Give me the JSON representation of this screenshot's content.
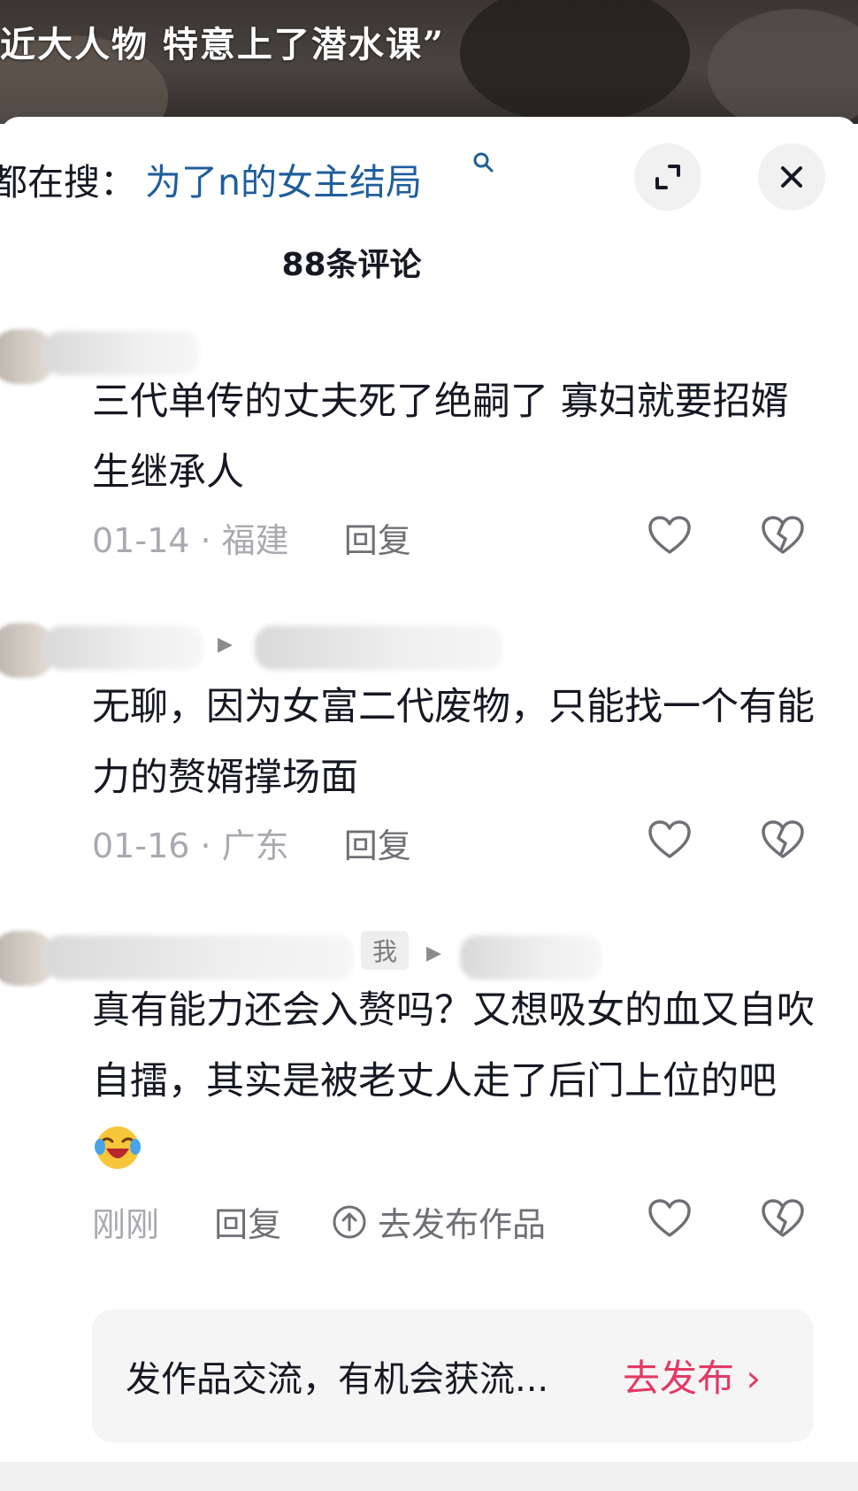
{
  "video": {
    "subtitle": "近大人物 特意上了潜水课”"
  },
  "header": {
    "search_prefix": "都在搜：",
    "search_query": "为了n的女主结局",
    "comment_count": "88条评论"
  },
  "comments": [
    {
      "text": "三代单传的丈夫死了绝嗣了 寡妇就要招婿 生继承人",
      "date": "01-14",
      "location": "福建",
      "reply_label": "回复"
    },
    {
      "text": "无聊，因为女富二代废物，只能找一个有能力的赘婿撑场面",
      "date": "01-16",
      "location": "广东",
      "reply_label": "回复"
    },
    {
      "me_badge": "我",
      "text": "真有能力还会入赘吗？又想吸女的血又自吹自擂，其实是被老丈人走了后门上位的吧",
      "emoji": "laughing-crying-emoji",
      "time": "刚刚",
      "reply_label": "回复",
      "publish_label": "去发布作品"
    }
  ],
  "promo": {
    "text": "发作品交流，有机会获流...",
    "button": "去发布",
    "chevron": "›"
  },
  "colors": {
    "search_query": "#1f5e9c",
    "promo_button": "#e23a64",
    "meta_gray": "#a9aab0"
  },
  "icons": [
    "search-icon",
    "expand-icon",
    "close-icon",
    "heart-icon",
    "broken-heart-icon",
    "upload-icon"
  ]
}
